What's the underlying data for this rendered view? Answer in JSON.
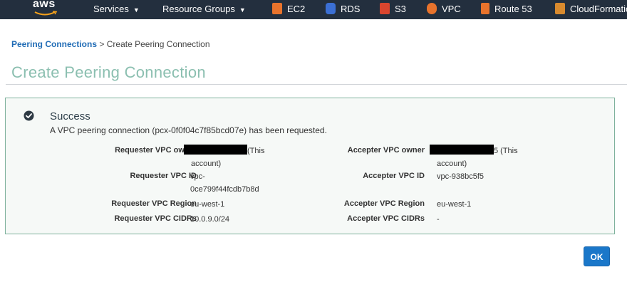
{
  "nav": {
    "logo_text": "aws",
    "menus": [
      {
        "label": "Services"
      },
      {
        "label": "Resource Groups"
      }
    ],
    "services": [
      {
        "label": "EC2",
        "icon": "ec2-icon",
        "color": "#e8732c"
      },
      {
        "label": "RDS",
        "icon": "rds-icon",
        "color": "#3b6fd4"
      },
      {
        "label": "S3",
        "icon": "s3-icon",
        "color": "#d9452e"
      },
      {
        "label": "VPC",
        "icon": "vpc-icon",
        "color": "#e8732c"
      },
      {
        "label": "Route 53",
        "icon": "route53-icon",
        "color": "#e8732c"
      },
      {
        "label": "CloudFormatio",
        "icon": "cloudformation-icon",
        "color": "#d88a2e"
      }
    ]
  },
  "breadcrumb": {
    "link": "Peering Connections",
    "separator": ">",
    "current": "Create Peering Connection"
  },
  "page": {
    "title": "Create Peering Connection"
  },
  "success": {
    "title": "Success",
    "message": "A VPC peering connection (pcx-0f0f04c7f85bcd07e) has been requested."
  },
  "requester": {
    "owner_label": "Requester VPC owner",
    "owner_suffix": "(This",
    "owner_suffix2": "account)",
    "vpc_id_label": "Requester VPC ID",
    "vpc_id_line1": "vpc-",
    "vpc_id_line2": "0ce799f44fcdb7b8d",
    "region_label": "Requester VPC Region",
    "region": "eu-west-1",
    "cidrs_label": "Requester VPC CIDRs",
    "cidrs": "10.0.9.0/24"
  },
  "accepter": {
    "owner_label": "Accepter VPC owner",
    "owner_suffix": "5 (This",
    "owner_suffix2": "account)",
    "vpc_id_label": "Accepter VPC ID",
    "vpc_id": "vpc-938bc5f5",
    "region_label": "Accepter VPC Region",
    "region": "eu-west-1",
    "cidrs_label": "Accepter VPC CIDRs",
    "cidrs": "-"
  },
  "ok_button": "OK",
  "colors": {
    "nav_bg": "#232f3e",
    "link": "#1f6bb5",
    "title": "#8bbfb0",
    "panel_border": "#7fb29d",
    "ok_button": "#1a77c9"
  }
}
